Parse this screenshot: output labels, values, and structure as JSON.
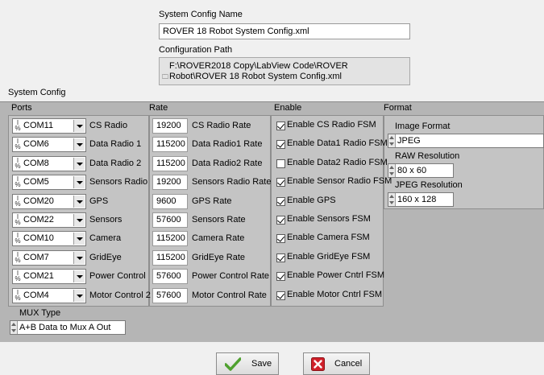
{
  "header": {
    "config_name_label": "System Config Name",
    "config_name_value": "ROVER 18 Robot System Config.xml",
    "config_path_label": "Configuration Path",
    "config_path_value": "F:\\ROVER2018 Copy\\LabView Code\\ROVER Robot\\ROVER 18 Robot System Config.xml"
  },
  "system_config": {
    "title": "System Config",
    "headers": {
      "ports": "Ports",
      "rate": "Rate",
      "enable": "Enable",
      "format": "Format"
    },
    "rows": [
      {
        "port": "COM11",
        "port_label": "CS Radio",
        "rate": "19200",
        "rate_label": "CS Radio Rate",
        "enable_label": "Enable CS Radio FSM",
        "enabled": true
      },
      {
        "port": "COM6",
        "port_label": "Data Radio 1",
        "rate": "115200",
        "rate_label": "Data Radio1 Rate",
        "enable_label": "Enable Data1 Radio FSM",
        "enabled": true
      },
      {
        "port": "COM8",
        "port_label": "Data Radio 2",
        "rate": "115200",
        "rate_label": "Data Radio2 Rate",
        "enable_label": "Enable Data2 Radio FSM",
        "enabled": false
      },
      {
        "port": "COM5",
        "port_label": "Sensors Radio",
        "rate": "19200",
        "rate_label": "Sensors Radio Rate",
        "enable_label": "Enable Sensor Radio FSM",
        "enabled": true
      },
      {
        "port": "COM20",
        "port_label": "GPS",
        "rate": "9600",
        "rate_label": "GPS Rate",
        "enable_label": "Enable GPS",
        "enabled": true
      },
      {
        "port": "COM22",
        "port_label": "Sensors",
        "rate": "57600",
        "rate_label": "Sensors Rate",
        "enable_label": "Enable Sensors FSM",
        "enabled": true
      },
      {
        "port": "COM10",
        "port_label": "Camera",
        "rate": "115200",
        "rate_label": "Camera Rate",
        "enable_label": "Enable Camera FSM",
        "enabled": true
      },
      {
        "port": "COM7",
        "port_label": "GridEye",
        "rate": "115200",
        "rate_label": "GridEye Rate",
        "enable_label": "Enable GridEye FSM",
        "enabled": true
      },
      {
        "port": "COM21",
        "port_label": "Power Control",
        "rate": "57600",
        "rate_label": "Power Control Rate",
        "enable_label": "Enable Power Cntrl FSM",
        "enabled": true
      },
      {
        "port": "COM4",
        "port_label": "Motor Control 2",
        "rate": "57600",
        "rate_label": "Motor Control Rate",
        "enable_label": "Enable Motor Cntrl FSM",
        "enabled": true
      }
    ],
    "format": {
      "image_format_label": "Image Format",
      "image_format_value": "JPEG",
      "raw_resolution_label": "RAW Resolution",
      "raw_resolution_value": "80 x 60",
      "jpeg_resolution_label": "JPEG Resolution",
      "jpeg_resolution_value": "160 x 128"
    },
    "mux": {
      "label": "MUX Type",
      "value": "A+B Data to Mux A Out"
    }
  },
  "buttons": {
    "save_label": "Save",
    "cancel_label": "Cancel"
  },
  "colors": {
    "panel": "#b5b5b5",
    "window": "#f0f0f0",
    "save_icon": "#4fa12f",
    "cancel_icon": "#d0202a"
  }
}
